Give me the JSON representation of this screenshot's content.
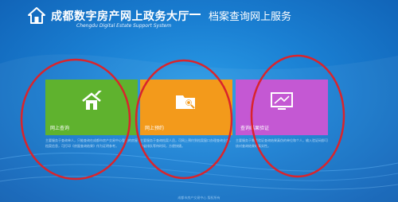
{
  "header": {
    "title": "成都数字房产网上政务大厅",
    "subtitle": "Chengdu Digital Estate Support System",
    "section": "档案查询网上服务"
  },
  "tiles": [
    {
      "label": "网上查询",
      "icon": "house-edit-icon",
      "color": "#5fb22e",
      "desc": "主要服务于查询单人，只能查询在成都市房产交易中心登记的房屋档案信息，可打印《房屋查询结果》作为证明参考。"
    },
    {
      "label": "网上预约",
      "icon": "folder-search-icon",
      "color": "#f39a1b",
      "desc": "主要服务于查询档案人员，可网上预约到档案窗口办理查询业务，节省排队等待时间，方便快捷。"
    },
    {
      "label": "查询结果验证",
      "icon": "monitor-verify-icon",
      "color": "#c458d3",
      "desc": "主要服务于需要验证查询结果真伪的单位和个人，输入验证码即可核对查询结果的真实性。"
    }
  ],
  "footer": {
    "text": "成都市房产交易中心 版权所有"
  },
  "annotation": {
    "color": "#d9242c"
  }
}
